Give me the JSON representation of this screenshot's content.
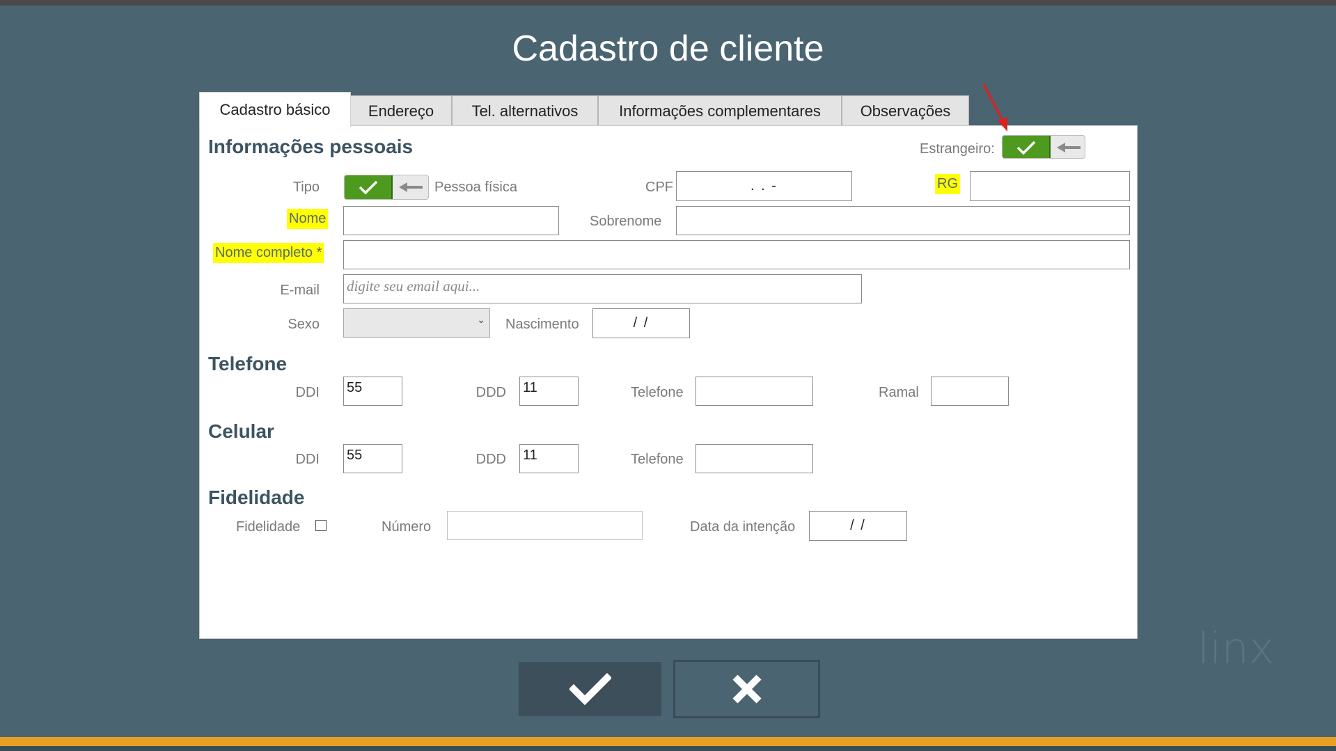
{
  "title": "Cadastro de cliente",
  "tabs": [
    "Cadastro básico",
    "Endereço",
    "Tel. alternativos",
    "Informações complementares",
    "Observações"
  ],
  "colors": {
    "background": "#4a6472",
    "toggle_on": "#4d9a1e",
    "highlight": "#ffff00",
    "accent_bar": "#e8a024"
  },
  "pessoais": {
    "heading": "Informações pessoais",
    "estrangeiro_label": "Estrangeiro:",
    "tipo_label": "Tipo",
    "tipo_value": "Pessoa física",
    "cpf_label": "CPF",
    "cpf_mask": ".  .  -",
    "rg_label": "RG",
    "nome_label": "Nome",
    "sobrenome_label": "Sobrenome",
    "nome_completo_label": "Nome completo *",
    "email_label": "E-mail",
    "email_placeholder": "digite seu email aqui...",
    "sexo_label": "Sexo",
    "nascimento_label": "Nascimento",
    "nascimento_mask": "/ /"
  },
  "telefone": {
    "heading": "Telefone",
    "ddi_label": "DDI",
    "ddi_value": "55",
    "ddd_label": "DDD",
    "ddd_value": "11",
    "telefone_label": "Telefone",
    "ramal_label": "Ramal"
  },
  "celular": {
    "heading": "Celular",
    "ddi_label": "DDI",
    "ddi_value": "55",
    "ddd_label": "DDD",
    "ddd_value": "11",
    "telefone_label": "Telefone"
  },
  "fidelidade": {
    "heading": "Fidelidade",
    "fidelidade_label": "Fidelidade",
    "numero_label": "Número",
    "data_label": "Data da intenção",
    "data_mask": "/ /"
  },
  "icons": {
    "confirm": "check-icon",
    "cancel": "close-icon",
    "toggle_off": "arrow-left-icon"
  },
  "watermark": "linx"
}
